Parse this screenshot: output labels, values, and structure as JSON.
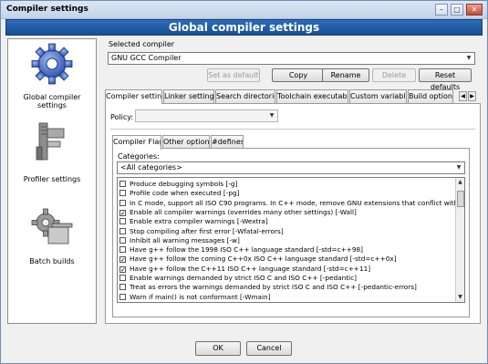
{
  "window": {
    "title": "Compiler settings",
    "header": "Global compiler settings"
  },
  "left_panel": {
    "items": [
      {
        "label": "Global compiler settings",
        "icon": "gear-icon"
      },
      {
        "label": "Profiler settings",
        "icon": "caliper-icon"
      },
      {
        "label": "Batch builds",
        "icon": "gears-icon"
      }
    ]
  },
  "selected_compiler": {
    "label": "Selected compiler",
    "value": "GNU GCC Compiler",
    "buttons": {
      "set_default": "Set as default",
      "copy": "Copy",
      "rename": "Rename",
      "delete": "Delete",
      "reset": "Reset defaults"
    }
  },
  "main_tabs": [
    "Compiler settings",
    "Linker settings",
    "Search directories",
    "Toolchain executables",
    "Custom variables",
    "Build options"
  ],
  "policy": {
    "label": "Policy:",
    "value": ""
  },
  "sub_tabs": [
    "Compiler Flags",
    "Other options",
    "#defines"
  ],
  "categories": {
    "label": "Categories:",
    "value": "<All categories>"
  },
  "flags": [
    {
      "text": "Produce debugging symbols  [-g]",
      "checked": false
    },
    {
      "text": "Profile code when executed  [-pg]",
      "checked": false
    },
    {
      "text": "In C mode, support all ISO C90 programs. In C++ mode, remove GNU extensions that conflict with ISO C++",
      "checked": false
    },
    {
      "text": "Enable all compiler warnings (overrides many other settings)  [-Wall]",
      "checked": true
    },
    {
      "text": "Enable extra compiler warnings  [-Wextra]",
      "checked": false
    },
    {
      "text": "Stop compiling after first error  [-Wfatal-errors]",
      "checked": false
    },
    {
      "text": "Inhibit all warning messages  [-w]",
      "checked": false
    },
    {
      "text": "Have g++ follow the 1998 ISO C++ language standard  [-std=c++98]",
      "checked": false
    },
    {
      "text": "Have g++ follow the coming C++0x ISO C++ language standard  [-std=c++0x]",
      "checked": true
    },
    {
      "text": "Have g++ follow the C++11 ISO C++ language standard  [-std=c++11]",
      "checked": true
    },
    {
      "text": "Enable warnings demanded by strict ISO C and ISO C++  [-pedantic]",
      "checked": false
    },
    {
      "text": "Treat as errors the warnings demanded by strict ISO C and ISO C++  [-pedantic-errors]",
      "checked": false
    },
    {
      "text": "Warn if main() is not conformant  [-Wmain]",
      "checked": false
    }
  ],
  "footer": {
    "ok": "OK",
    "cancel": "Cancel"
  }
}
